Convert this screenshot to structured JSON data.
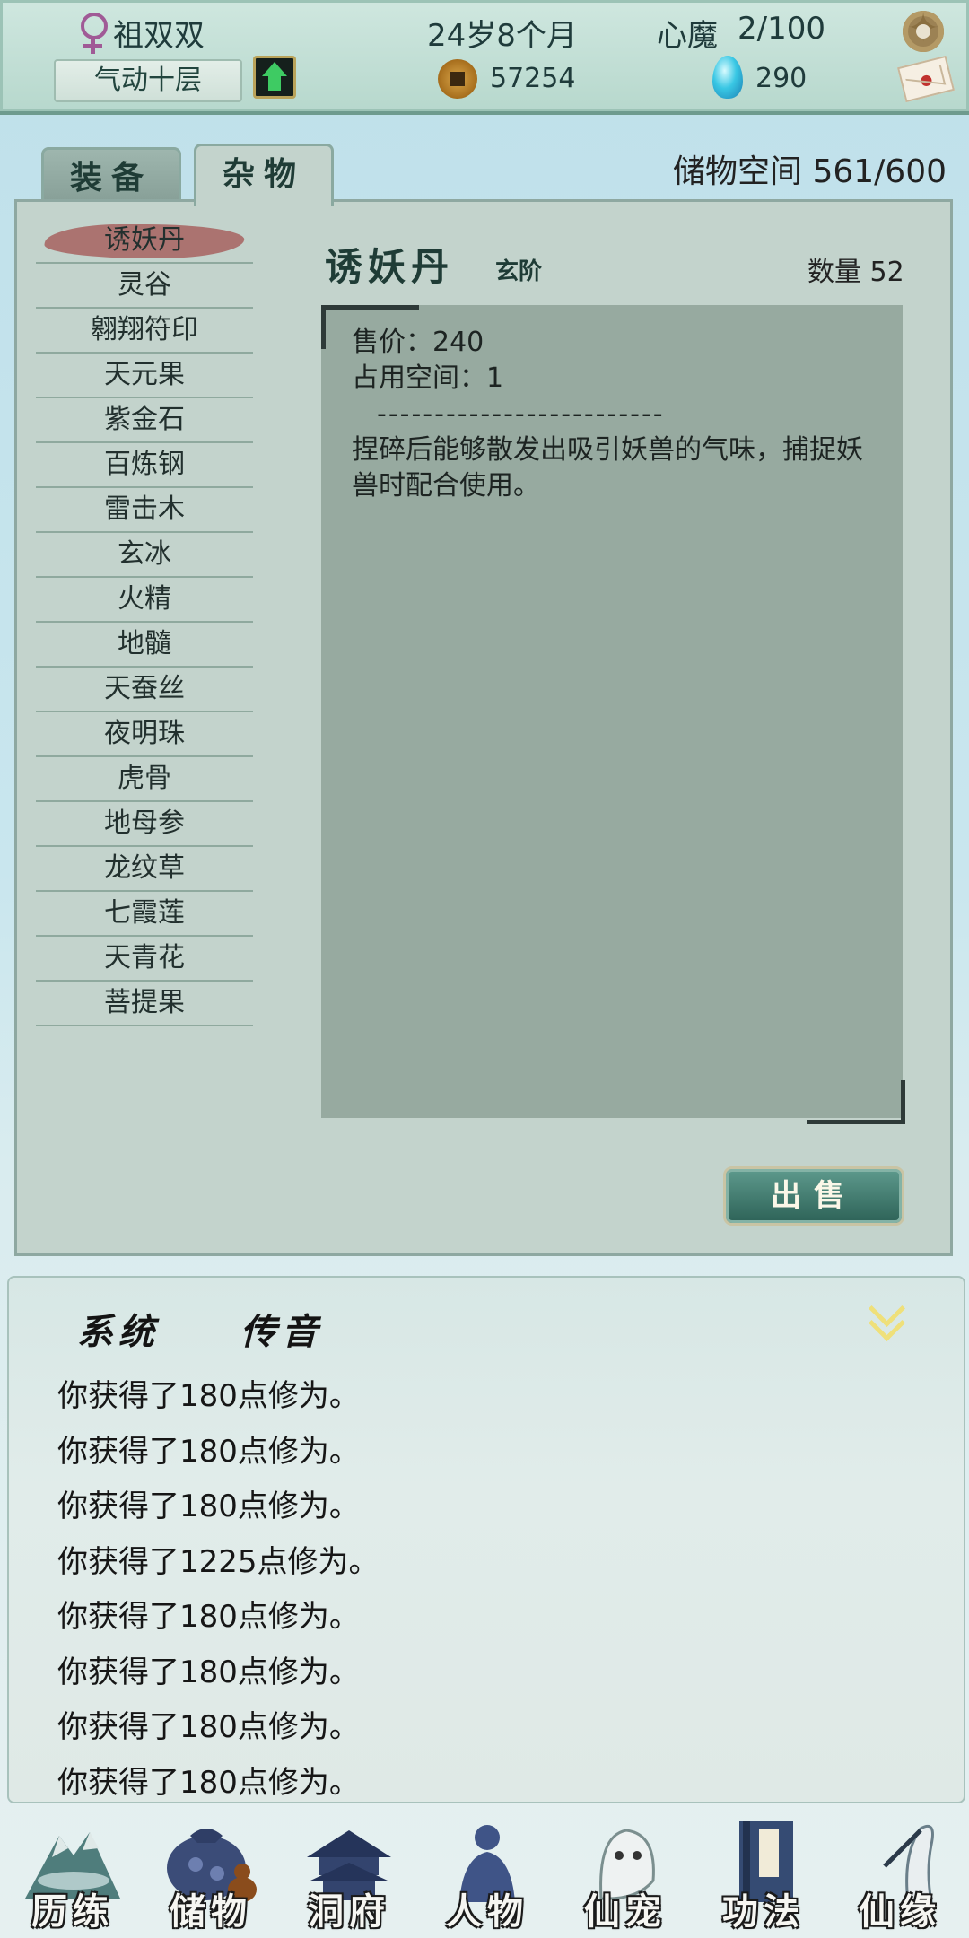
{
  "status": {
    "player_name": "祖双双",
    "age": "24岁8个月",
    "demon_label": "心魔",
    "demon_value": "2/100",
    "realm": "气动十层",
    "coins": "57254",
    "gems": "290"
  },
  "storage": {
    "tabs": [
      "装备",
      "杂物"
    ],
    "active_tab": "杂物",
    "capacity_label": "储物空间",
    "capacity_value": "561/600",
    "items": [
      "诱妖丹",
      "灵谷",
      "翱翔符印",
      "天元果",
      "紫金石",
      "百炼钢",
      "雷击木",
      "玄冰",
      "火精",
      "地髓",
      "天蚕丝",
      "夜明珠",
      "虎骨",
      "地母参",
      "龙纹草",
      "七霞莲",
      "天青花",
      "菩提果"
    ],
    "selected_item": "诱妖丹",
    "detail": {
      "name": "诱妖丹",
      "grade": "玄阶",
      "quantity_label": "数量",
      "quantity": "52",
      "price": "售价：240",
      "space": "占用空间：1",
      "divider": "-------------------------",
      "description": "捏碎后能够散发出吸引妖兽的气味，捕捉妖兽时配合使用。"
    },
    "sell_label": "出售"
  },
  "log": {
    "tabs": [
      "系统",
      "传音"
    ],
    "messages": [
      "你获得了180点修为。",
      "你获得了180点修为。",
      "你获得了180点修为。",
      "你获得了1225点修为。",
      "你获得了180点修为。",
      "你获得了180点修为。",
      "你获得了180点修为。",
      "你获得了180点修为。"
    ]
  },
  "nav": [
    "历练",
    "储物",
    "洞府",
    "人物",
    "仙宠",
    "功法",
    "仙缘"
  ],
  "colors": {
    "accent": "#2d6257",
    "panel": "#c3d3cc",
    "selected_highlight": "#a7615f",
    "coin_gold": "#d9a64a",
    "gem_blue": "#39c7e4"
  }
}
